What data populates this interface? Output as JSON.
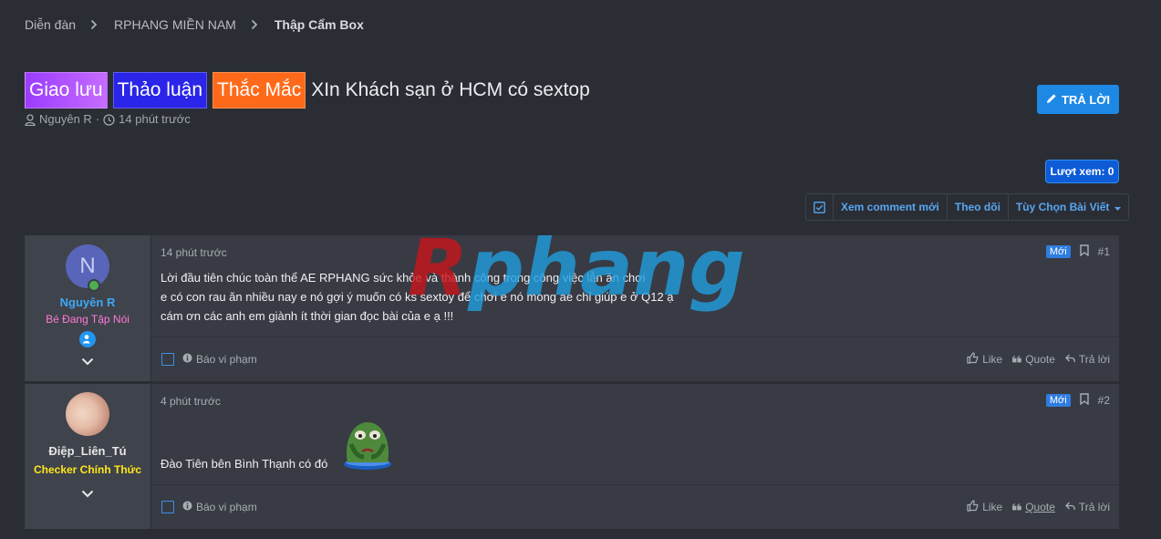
{
  "breadcrumb": [
    "Diễn đàn",
    "RPHANG MIỀN NAM",
    "Thập Cẩm Box"
  ],
  "thread": {
    "labels": [
      "Giao lưu",
      "Thảo luận",
      "Thắc Mắc"
    ],
    "title": "XIn Khách sạn ở HCM có sextop",
    "author": "Nguyên R",
    "time": "14 phút trước"
  },
  "reply_button": "TRẢ LỜI",
  "views": "Lượt xem: 0",
  "filters": {
    "new_comments": "Xem comment mới",
    "follow": "Theo dõi",
    "options": "Tùy Chọn Bài Viết"
  },
  "watermark": "Rphang",
  "posts": [
    {
      "avatar_letter": "N",
      "username": "Nguyên R",
      "username_color": "#3ea8f5",
      "user_title": "Bé Đang Tập Nói",
      "user_title_color": "#ff7ad6",
      "time": "14 phút trước",
      "badge": "Mới",
      "number": "#1",
      "lines": [
        "Lời đầu tiên chúc toàn thể AE RPHANG sức khỏe và thành công trong công việc lẫn ăn chơi",
        "e có con rau ăn nhiều nay e nó gợi ý muốn có ks sextoy để chơi e nó mong ae chỉ giúp e ở Q12 ạ",
        "cám ơn các anh em giành ít thời gian đọc bài của e ạ !!!"
      ],
      "report": "Báo vi phạm",
      "like": "Like",
      "quote": "Quote",
      "reply": "Trả lời"
    },
    {
      "username": "Điệp_Liên_Tú",
      "username_color": "#e8e8e8",
      "user_title": "Checker Chính Thức",
      "user_title_color": "#ffe619",
      "time": "4 phút trước",
      "badge": "Mới",
      "number": "#2",
      "lines": [
        "Đào Tiên bên Bình Thạnh có đó"
      ],
      "report": "Báo vi phạm",
      "like": "Like",
      "quote": "Quote",
      "reply": "Trả lời"
    }
  ]
}
